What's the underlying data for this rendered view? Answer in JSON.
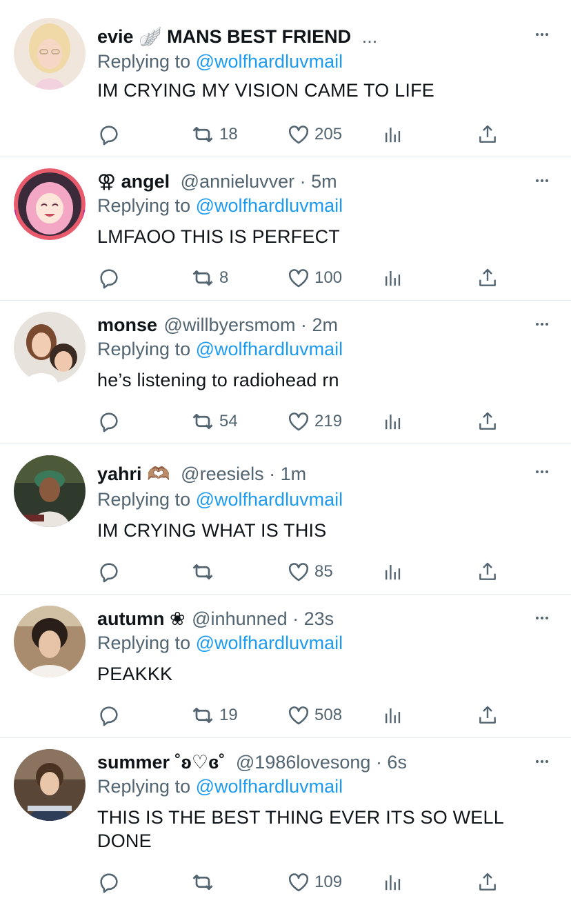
{
  "icons": {
    "reply": "reply-icon",
    "retweet": "retweet-icon",
    "like": "heart-icon",
    "stats": "analytics-icon",
    "share": "share-icon",
    "more": "more-icon"
  },
  "colors": {
    "link": "#1d9bf0",
    "secondary_text": "#536471",
    "primary_text": "#0f1419",
    "divider": "#e6ecf0"
  },
  "tweets": [
    {
      "name": "evie 🪽 MANS BEST FRIEND",
      "meta": "...",
      "replying_prefix": "Replying to",
      "mention": "@wolfhardluvmail",
      "text": "IM CRYING MY VISION CAME TO LIFE",
      "retweets": "18",
      "likes": "205"
    },
    {
      "name": "⚢ angel",
      "meta": "@annieluvver · 5m",
      "replying_prefix": "Replying to",
      "mention": "@wolfhardluvmail",
      "text": "LMFAOO THIS IS PERFECT",
      "retweets": "8",
      "likes": "100"
    },
    {
      "name": "monse",
      "meta": "@willbyersmom · 2m",
      "replying_prefix": "Replying to",
      "mention": "@wolfhardluvmail",
      "text": "he’s listening to radiohead rn",
      "retweets": "54",
      "likes": "219"
    },
    {
      "name": "yahri 🫶🏽",
      "meta": "@reesiels · 1m",
      "replying_prefix": "Replying to",
      "mention": "@wolfhardluvmail",
      "text": "IM CRYING WHAT IS THIS",
      "retweets": "",
      "likes": "85"
    },
    {
      "name": "autumn ❀",
      "meta": "@inhunned · 23s",
      "replying_prefix": "Replying to",
      "mention": "@wolfhardluvmail",
      "text": "PEAKKK",
      "retweets": "19",
      "likes": "508"
    },
    {
      "name": "summer ˚ʚ♡ɞ˚",
      "meta": "@1986lovesong · 6s",
      "replying_prefix": "Replying to",
      "mention": "@wolfhardluvmail",
      "text": "THIS IS THE BEST THING EVER ITS SO WELL DONE",
      "retweets": "",
      "likes": "109"
    }
  ]
}
